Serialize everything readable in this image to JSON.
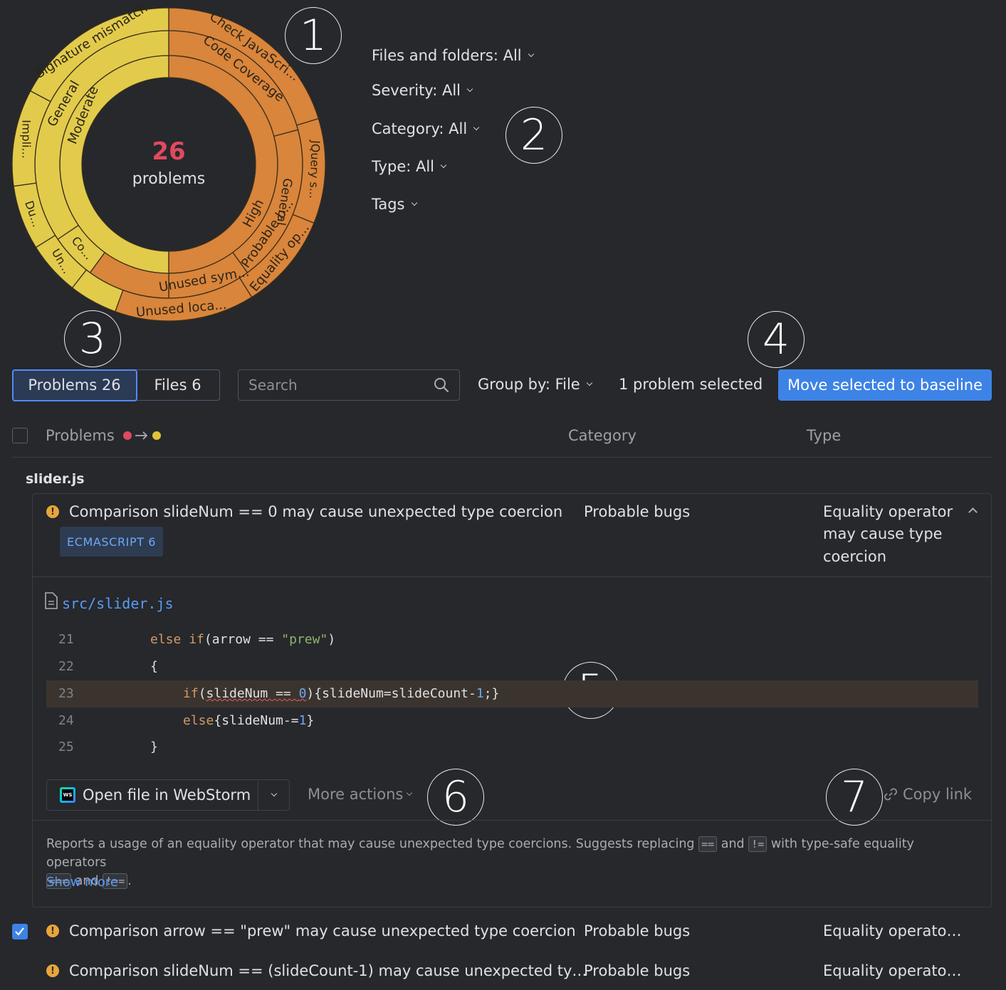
{
  "summary": {
    "count": "26",
    "label": "problems"
  },
  "sunburst_labels": {
    "outer": [
      "Signature mismatch",
      "Check JavaScri...",
      "JQuery s...",
      "Equality op...",
      "Unused loca...",
      "Un...",
      "Du...",
      "Impli..."
    ],
    "middle": [
      "General",
      "Code Coverage",
      "General",
      "Probable b...",
      "Unused sym...",
      "Co..."
    ],
    "inner": [
      "Moderate",
      "High"
    ]
  },
  "callouts": [
    "1",
    "2",
    "3",
    "4",
    "5",
    "6",
    "7"
  ],
  "filters": {
    "files": "Files and folders: All",
    "severity": "Severity: All",
    "category": "Category: All",
    "type": "Type: All",
    "tags": "Tags"
  },
  "toolbar": {
    "tab_problems": "Problems 26",
    "tab_files": "Files 6",
    "search_placeholder": "Search",
    "group_by": "Group by: File",
    "selected_count": "1 problem selected",
    "baseline_button": "Move selected to baseline"
  },
  "table": {
    "col_problems": "Problems",
    "col_category": "Category",
    "col_type": "Type"
  },
  "file_group": "slider.js",
  "expanded_problem": {
    "title": "Comparison slideNum == 0 may cause unexpected type coercion",
    "tag": "ECMASCRIPT 6",
    "category": "Probable bugs",
    "type_lines": [
      "Equality operator",
      "may cause type",
      "coercion"
    ],
    "file_path": "src/slider.js",
    "code_lines": [
      {
        "n": "21"
      },
      {
        "n": "22"
      },
      {
        "n": "23"
      },
      {
        "n": "24"
      },
      {
        "n": "25"
      }
    ],
    "open_button": "Open file in WebStorm",
    "more_actions": "More actions",
    "copy_link": "Copy link",
    "description": {
      "part1": "Reports a usage of an equality operator that may cause unexpected type coercions. Suggests replacing ",
      "op1": "==",
      "and1": " and ",
      "op2": "!=",
      "part2": " with type-safe equality operators",
      "op3": "===",
      "and2": " and ",
      "op4": "!==",
      "end": "."
    },
    "show_more": "Show more"
  },
  "rows": [
    {
      "title": "Comparison arrow == \"prew\" may cause unexpected type coercion",
      "category": "Probable bugs",
      "type": "Equality operato…"
    },
    {
      "title": "Comparison slideNum == (slideCount-1) may cause unexpected ty…",
      "category": "Probable bugs",
      "type": "Equality operato…"
    }
  ],
  "colors": {
    "accent": "#3d83e6",
    "problem_count": "#e0495f",
    "high": "#d9853b",
    "moderate": "#e2cb4b"
  }
}
